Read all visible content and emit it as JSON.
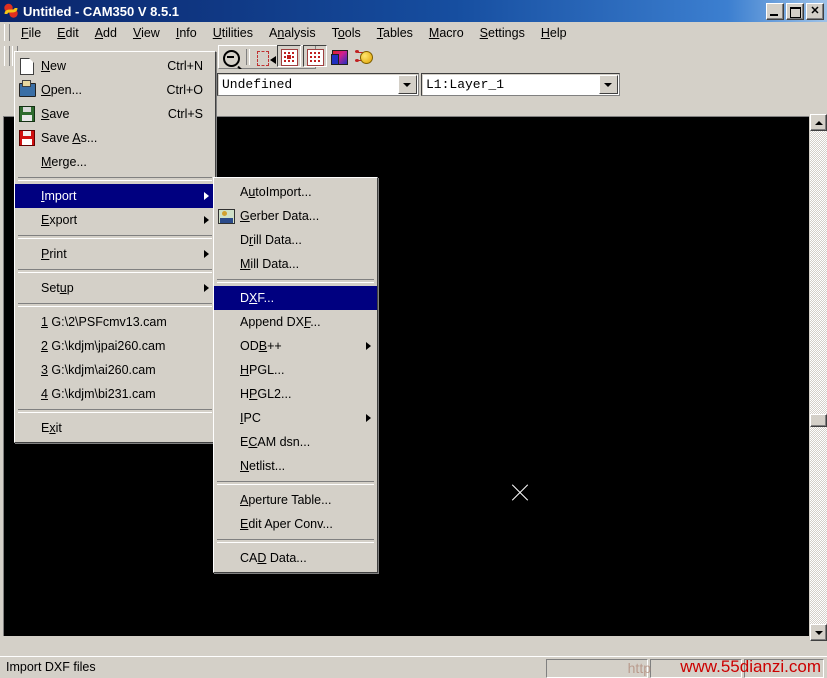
{
  "window": {
    "title": "Untitled - CAM350 V 8.5.1",
    "icon": "cam350-logo-icon",
    "buttons": {
      "minimize": "minimize-button",
      "maximize": "maximize-button",
      "close": "close-button",
      "close_glyph": "✕"
    }
  },
  "menubar": [
    {
      "label": "File",
      "accesskey": "F",
      "active": true
    },
    {
      "label": "Edit",
      "accesskey": "E",
      "active": false
    },
    {
      "label": "Add",
      "accesskey": "A",
      "active": false
    },
    {
      "label": "View",
      "accesskey": "V",
      "active": false
    },
    {
      "label": "Info",
      "accesskey": "I",
      "active": false
    },
    {
      "label": "Utilities",
      "accesskey": "U",
      "active": false
    },
    {
      "label": "Analysis",
      "accesskey": "n",
      "active": false
    },
    {
      "label": "Tools",
      "accesskey": "o",
      "active": false
    },
    {
      "label": "Tables",
      "accesskey": "T",
      "active": false
    },
    {
      "label": "Macro",
      "accesskey": "M",
      "active": false
    },
    {
      "label": "Settings",
      "accesskey": "S",
      "active": false
    },
    {
      "label": "Help",
      "accesskey": "H",
      "active": false
    }
  ],
  "toolbar": {
    "tools": [
      {
        "name": "zoom-out-icon",
        "pressed": false
      },
      {
        "name": "select-rect-icon",
        "pressed": false
      },
      {
        "name": "grid-snap-icon",
        "pressed": true
      },
      {
        "name": "grid-display-icon",
        "pressed": true
      },
      {
        "name": "layer-colors-icon",
        "pressed": false
      },
      {
        "name": "netlist-icon",
        "pressed": false
      }
    ]
  },
  "combos": {
    "layer_type": {
      "value": "Undefined",
      "name": "layer-type-combo"
    },
    "layer": {
      "value": "L1:Layer_1",
      "name": "active-layer-combo"
    }
  },
  "file_menu": {
    "items": [
      {
        "type": "item",
        "label": "New",
        "accesskey": "N",
        "accel": "Ctrl+N",
        "icon": "new-file-icon",
        "submenu": false,
        "selected": false
      },
      {
        "type": "item",
        "label": "Open...",
        "accesskey": "O",
        "accel": "Ctrl+O",
        "icon": "open-folder-icon",
        "submenu": false,
        "selected": false
      },
      {
        "type": "item",
        "label": "Save",
        "accesskey": "S",
        "accel": "Ctrl+S",
        "icon": "save-disk-icon",
        "submenu": false,
        "selected": false
      },
      {
        "type": "item",
        "label": "Save As...",
        "accesskey": "A",
        "accel": "",
        "icon": "save-as-icon",
        "submenu": false,
        "selected": false
      },
      {
        "type": "item",
        "label": "Merge...",
        "accesskey": "M",
        "accel": "",
        "icon": "",
        "submenu": false,
        "selected": false
      },
      {
        "type": "sep"
      },
      {
        "type": "item",
        "label": "Import",
        "accesskey": "I",
        "accel": "",
        "icon": "",
        "submenu": true,
        "selected": true
      },
      {
        "type": "item",
        "label": "Export",
        "accesskey": "E",
        "accel": "",
        "icon": "",
        "submenu": true,
        "selected": false
      },
      {
        "type": "sep"
      },
      {
        "type": "item",
        "label": "Print",
        "accesskey": "P",
        "accel": "",
        "icon": "",
        "submenu": true,
        "selected": false
      },
      {
        "type": "sep"
      },
      {
        "type": "item",
        "label": "Setup",
        "accesskey": "u",
        "accel": "",
        "icon": "",
        "submenu": true,
        "selected": false
      },
      {
        "type": "sep"
      },
      {
        "type": "item",
        "label": "1 G:\\2\\PSFcmv13.cam",
        "accesskey": "1",
        "accel": "",
        "icon": "",
        "submenu": false,
        "selected": false
      },
      {
        "type": "item",
        "label": "2 G:\\kdjm\\jpai260.cam",
        "accesskey": "2",
        "accel": "",
        "icon": "",
        "submenu": false,
        "selected": false
      },
      {
        "type": "item",
        "label": "3 G:\\kdjm\\ai260.cam",
        "accesskey": "3",
        "accel": "",
        "icon": "",
        "submenu": false,
        "selected": false
      },
      {
        "type": "item",
        "label": "4 G:\\kdjm\\bi231.cam",
        "accesskey": "4",
        "accel": "",
        "icon": "",
        "submenu": false,
        "selected": false
      },
      {
        "type": "sep"
      },
      {
        "type": "item",
        "label": "Exit",
        "accesskey": "x",
        "accel": "",
        "icon": "",
        "submenu": false,
        "selected": false
      }
    ]
  },
  "import_submenu": {
    "items": [
      {
        "type": "item",
        "label": "AutoImport...",
        "icon": "",
        "submenu": false,
        "selected": false
      },
      {
        "type": "item",
        "label": "Gerber Data...",
        "icon": "gerber-data-icon",
        "submenu": false,
        "selected": false
      },
      {
        "type": "item",
        "label": "Drill Data...",
        "icon": "",
        "submenu": false,
        "selected": false
      },
      {
        "type": "item",
        "label": "Mill Data...",
        "icon": "",
        "submenu": false,
        "selected": false
      },
      {
        "type": "sep"
      },
      {
        "type": "item",
        "label": "DXF...",
        "icon": "",
        "submenu": false,
        "selected": true
      },
      {
        "type": "item",
        "label": "Append DXF...",
        "icon": "",
        "submenu": false,
        "selected": false
      },
      {
        "type": "item",
        "label": "ODB++",
        "icon": "",
        "submenu": true,
        "selected": false
      },
      {
        "type": "item",
        "label": "HPGL...",
        "icon": "",
        "submenu": false,
        "selected": false
      },
      {
        "type": "item",
        "label": "HPGL2...",
        "icon": "",
        "submenu": false,
        "selected": false
      },
      {
        "type": "item",
        "label": "IPC",
        "icon": "",
        "submenu": true,
        "selected": false
      },
      {
        "type": "item",
        "label": "ECAM dsn...",
        "icon": "",
        "submenu": false,
        "selected": false
      },
      {
        "type": "item",
        "label": "Netlist...",
        "icon": "",
        "submenu": false,
        "selected": false
      },
      {
        "type": "sep"
      },
      {
        "type": "item",
        "label": "Aperture Table...",
        "icon": "",
        "submenu": false,
        "selected": false
      },
      {
        "type": "item",
        "label": "Edit Aper Conv...",
        "icon": "",
        "submenu": false,
        "selected": false
      },
      {
        "type": "sep"
      },
      {
        "type": "item",
        "label": "CAD Data...",
        "icon": "",
        "submenu": false,
        "selected": false
      }
    ]
  },
  "statusbar": {
    "message": "Import DXF files",
    "watermark": "www.55dianzi.com",
    "watermark_small": "http"
  },
  "colors": {
    "face": "#d4d0c8",
    "highlight": "#000080",
    "title_start": "#0a246a",
    "canvas": "#000000",
    "watermark": "#cc0000"
  }
}
